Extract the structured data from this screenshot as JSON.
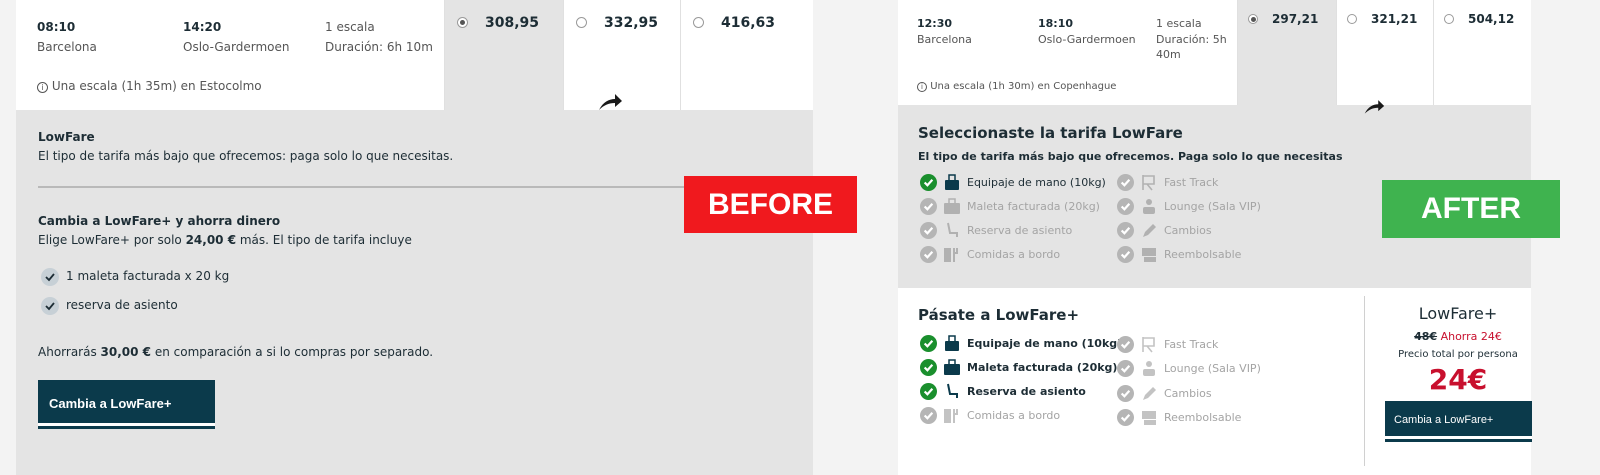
{
  "before": {
    "badge": "BEFORE",
    "flight": {
      "dep_time": "08:10",
      "dep_city": "Barcelona",
      "arr_time": "14:20",
      "arr_city": "Oslo-Gardermoen",
      "stops": "1 escala",
      "duration": "Duración: 6h 10m",
      "stop_info": "Una escala (1h 35m) en Estocolmo",
      "prices": [
        "308,95",
        "332,95",
        "416,63"
      ]
    },
    "fare_name": "LowFare",
    "fare_desc": "El tipo de tarifa más bajo que ofrecemos: paga solo lo que necesitas.",
    "upsell_title": "Cambia a LowFare+ y ahorra dinero",
    "upsell_desc_pre": "Elige LowFare+ por solo ",
    "upsell_desc_amount": "24,00 €",
    "upsell_desc_post": " más. El tipo de tarifa incluye",
    "items": [
      "1 maleta facturada x 20 kg",
      "reserva de asiento"
    ],
    "savings_pre": "Ahorrarás ",
    "savings_amount": "30,00 €",
    "savings_post": " en comparación a si lo compras por separado.",
    "button": "Cambia a LowFare+"
  },
  "after": {
    "badge": "AFTER",
    "flight": {
      "dep_time": "12:30",
      "dep_city": "Barcelona",
      "arr_time": "18:10",
      "arr_city": "Oslo-Gardermoen",
      "stops": "1 escala",
      "duration_line1": "Duración: 5h",
      "duration_line2": "40m",
      "stop_info": "Una escala (1h 30m) en Copenhague",
      "prices": [
        "297,21",
        "321,21",
        "504,12"
      ]
    },
    "selected_title": "Seleccionaste la tarifa LowFare",
    "selected_desc": "El tipo de tarifa más bajo que ofrecemos. Paga solo lo que necesitas",
    "features_left": [
      "Equipaje de mano (10kg)",
      "Maleta facturada (20kg)",
      "Reserva de asiento",
      "Comidas a bordo"
    ],
    "features_right": [
      "Fast Track",
      "Lounge (Sala VIP)",
      "Cambios",
      "Reembolsable"
    ],
    "upgrade_title": "Pásate a LowFare+",
    "upgrade_left": [
      "Equipaje de mano (10kg)",
      "Maleta facturada (20kg)",
      "Reserva de asiento",
      "Comidas a bordo"
    ],
    "upgrade_right": [
      "Fast Track",
      "Lounge (Sala VIP)",
      "Cambios",
      "Reembolsable"
    ],
    "card": {
      "title": "LowFare+",
      "old_price": "48€",
      "now_price": "Ahorra 24€",
      "per_person": "Precio total por persona",
      "big_price": "24€",
      "button": "Cambia a LowFare+"
    }
  },
  "colors": {
    "before_badge": "#f0191e",
    "after_badge": "#3fb34f",
    "button": "#0b3a4b",
    "check_green": "#1a8f2d",
    "price_red": "#c8102e"
  }
}
